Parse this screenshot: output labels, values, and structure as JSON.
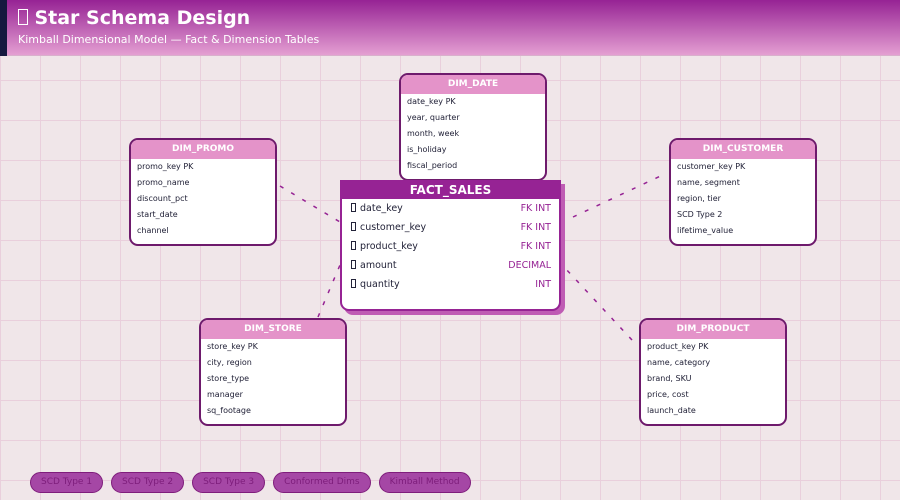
{
  "header": {
    "title": "Star Schema Design",
    "title_icon": "star-icon",
    "subtitle": "Kimball Dimensional Model — Fact & Dimension Tables"
  },
  "fact": {
    "name": "FACT_SALES",
    "columns": [
      {
        "name": "date_key",
        "type": "FK INT"
      },
      {
        "name": "customer_key",
        "type": "FK INT"
      },
      {
        "name": "product_key",
        "type": "FK INT"
      },
      {
        "name": "amount",
        "type": "DECIMAL"
      },
      {
        "name": "quantity",
        "type": "INT"
      }
    ]
  },
  "dims": {
    "date": {
      "name": "DIM_DATE",
      "rows": [
        "date_key PK",
        "year, quarter",
        "month, week",
        "is_holiday",
        "fiscal_period"
      ]
    },
    "promo": {
      "name": "DIM_PROMO",
      "rows": [
        "promo_key PK",
        "promo_name",
        "discount_pct",
        "start_date",
        "channel"
      ]
    },
    "customer": {
      "name": "DIM_CUSTOMER",
      "rows": [
        "customer_key PK",
        "name, segment",
        "region, tier",
        "SCD Type 2",
        "lifetime_value"
      ]
    },
    "store": {
      "name": "DIM_STORE",
      "rows": [
        "store_key PK",
        "city, region",
        "store_type",
        "manager",
        "sq_footage"
      ]
    },
    "product": {
      "name": "DIM_PRODUCT",
      "rows": [
        "product_key PK",
        "name, category",
        "brand, SKU",
        "price, cost",
        "launch_date"
      ]
    }
  },
  "tags": [
    "SCD Type 1",
    "SCD Type 2",
    "SCD Type 3",
    "Conformed Dims",
    "Kimball Method"
  ],
  "colors": {
    "primary": "#962394",
    "light": "#e493c9",
    "border": "#6e1a6c",
    "background": "#f0e6e9"
  }
}
